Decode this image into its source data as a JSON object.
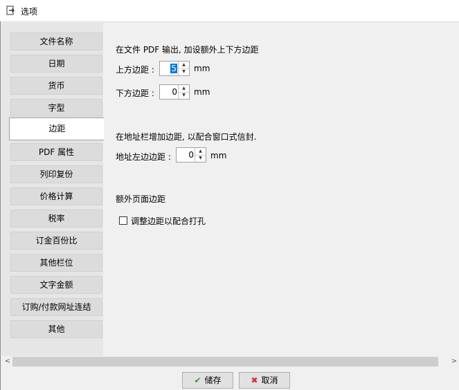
{
  "window": {
    "title": "选项"
  },
  "nav": {
    "items": [
      {
        "label": "文件名称"
      },
      {
        "label": "日期"
      },
      {
        "label": "货币"
      },
      {
        "label": "字型"
      },
      {
        "label": "边距"
      },
      {
        "label": "PDF 属性"
      },
      {
        "label": "列印复份"
      },
      {
        "label": "价格计算"
      },
      {
        "label": "税率"
      },
      {
        "label": "订金百份比"
      },
      {
        "label": "其他栏位"
      },
      {
        "label": "文字金额"
      },
      {
        "label": "订购/付款网址连结"
      },
      {
        "label": "其他"
      }
    ],
    "active_index": 4
  },
  "margins": {
    "pdf_heading": "在文件 PDF 输出, 加设额外上下方边距",
    "top_label": "上方边距 :",
    "top_value": "5",
    "bottom_label": "下方边距 :",
    "bottom_value": "0",
    "unit": "mm",
    "address_heading": "在地址栏增加边距, 以配合窗口式信封.",
    "address_left_label": "地址左边边距 :",
    "address_left_value": "0",
    "extra_heading": "额外页面边距",
    "punch_checkbox_label": "调整边距以配合打孔",
    "punch_checked": false
  },
  "buttons": {
    "save": "储存",
    "cancel": "取消"
  },
  "icons": {
    "save": "checkmark-icon",
    "cancel": "cross-icon",
    "app": "export-icon"
  },
  "colors": {
    "selection": "#0078d7",
    "save_icon": "#2e9e2e",
    "cancel_icon": "#d03030"
  }
}
